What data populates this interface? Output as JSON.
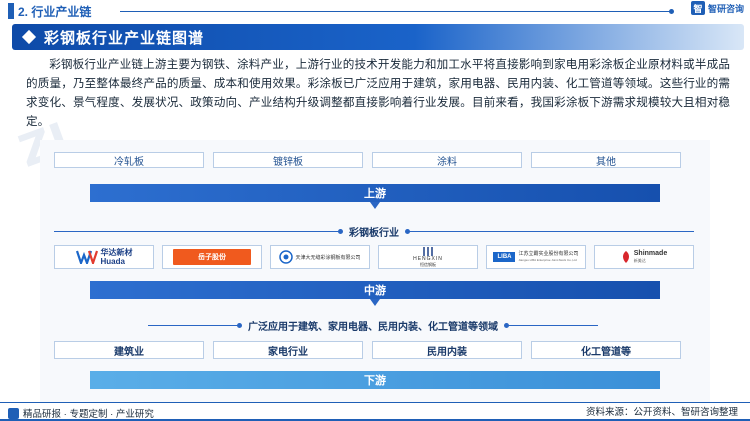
{
  "header": {
    "section_label": "2. 行业产业链",
    "brand_name": "智研咨询",
    "brand_icon_char": "智"
  },
  "title": "彩钢板行业产业链图谱",
  "intro": "彩钢板行业产业链上游主要为钢铁、涂料产业，上游行业的技术开发能力和加工水平将直接影响到家电用彩涂板企业原材料或半成品的质量，乃至整体最终产品的质量、成本和使用效果。彩涂板已广泛应用于建筑，家用电器、民用内装、化工管道等领域。这些行业的需求变化、景气程度、发展状况、政策动向、产业结构升级调整都直接影响着行业发展。目前来看，我国彩涂板下游需求规模较大且相对稳定。",
  "upstream": {
    "items": [
      "冷轧板",
      "镀锌板",
      "涂料",
      "其他"
    ],
    "label": "上游"
  },
  "midstream": {
    "header": "彩钢板行业",
    "logos": [
      {
        "name": "华达新材",
        "sub": "Huada"
      },
      {
        "name": "岳子股份",
        "sub": ""
      },
      {
        "name": "天津大无缝彩涂钢板有限公司",
        "sub": ""
      },
      {
        "name": "HENGXIN",
        "sub": "恒信钢板"
      },
      {
        "name": "江苏立霸实业股份有限公司",
        "sub": "Jiangsu LIBA Enterprise Joint-Stock Co.,Ltd"
      },
      {
        "name": "Shinmade",
        "sub": "新美达"
      }
    ],
    "label": "中游"
  },
  "downstream": {
    "header": "广泛应用于建筑、家用电器、民用内装、化工管道等领域",
    "items": [
      "建筑业",
      "家电行业",
      "民用内装",
      "化工管道等"
    ],
    "label": "下游"
  },
  "footer": {
    "left": "精品研报 · 专题定制 · 产业研究",
    "source": "资料来源：公开资料、智研咨询整理"
  },
  "colors": {
    "primary": "#1f5fb6",
    "bar_dark": "#1650ae",
    "bar_light": "#3a8fd8"
  }
}
